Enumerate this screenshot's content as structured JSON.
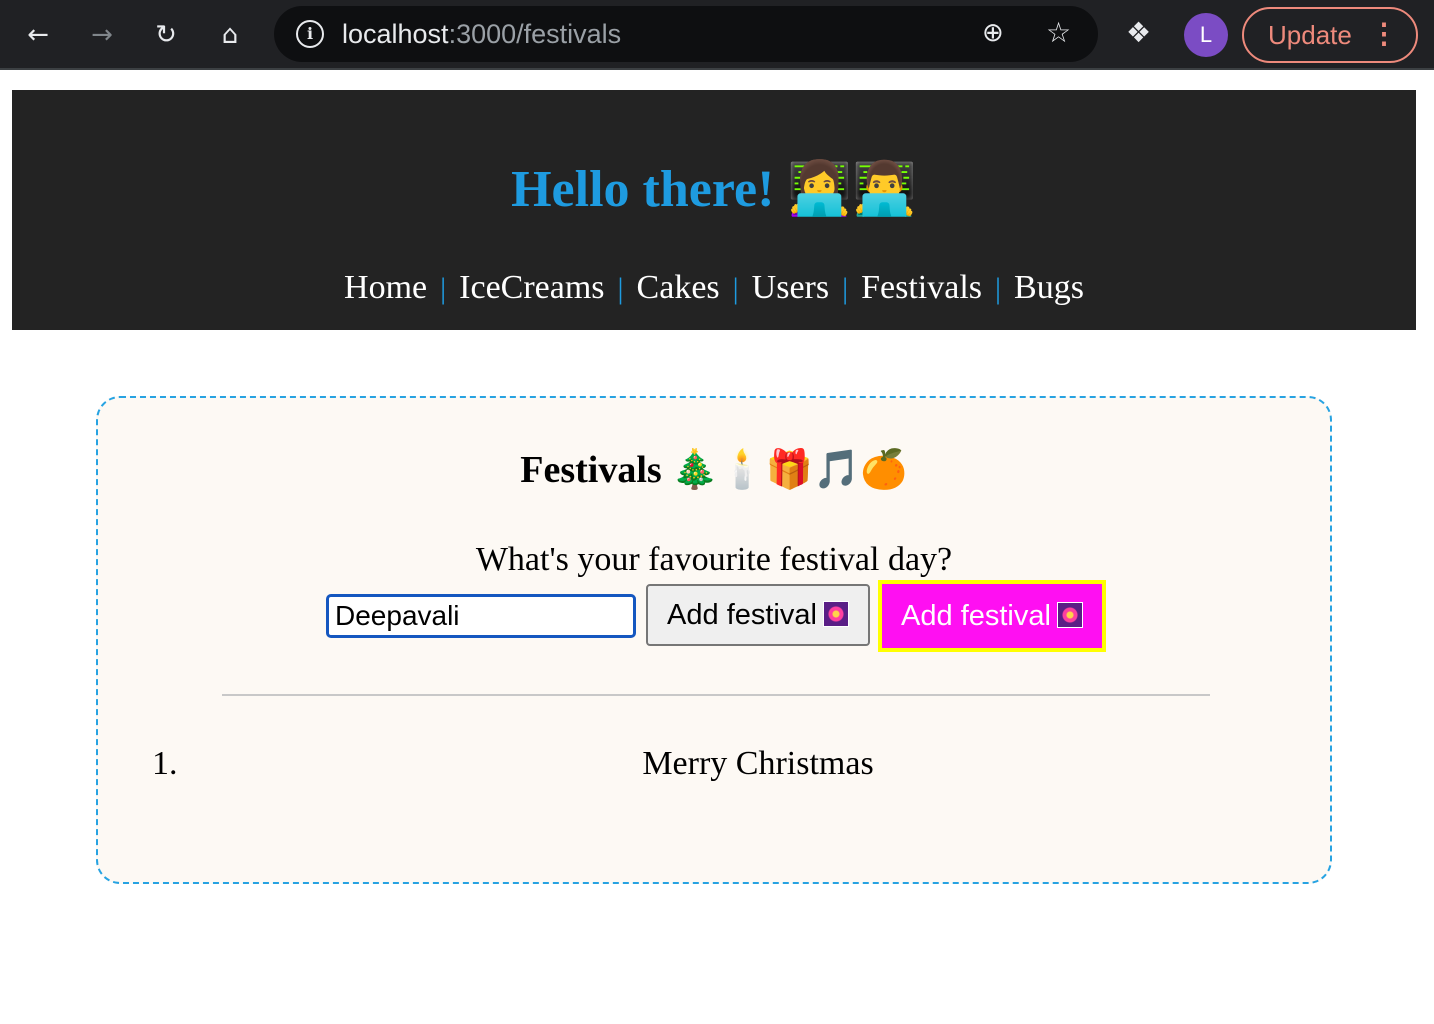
{
  "browser": {
    "url_host": "localhost",
    "url_path": ":3000/festivals",
    "back_icon": "arrow-left",
    "forward_icon": "arrow-right",
    "reload_icon": "reload",
    "home_icon": "home",
    "avatar_letter": "L",
    "update_label": "Update"
  },
  "header": {
    "title": "Hello there!",
    "title_emoji": "👩‍💻👨‍💻",
    "nav": [
      {
        "label": "Home"
      },
      {
        "label": "IceCreams"
      },
      {
        "label": "Cakes"
      },
      {
        "label": "Users"
      },
      {
        "label": "Festivals"
      },
      {
        "label": "Bugs"
      }
    ],
    "separator": "|",
    "accent_color": "#1e9be0"
  },
  "festivals": {
    "title": "Festivals",
    "title_emoji": "🎄🕯️🎁🎵🍊",
    "question": "What's your favourite festival day?",
    "input_value": "Deepavali",
    "add_button_label": "Add festival",
    "add_button_styled_label": "Add festival",
    "list": [
      {
        "number": "1.",
        "name": "Merry Christmas"
      }
    ]
  }
}
